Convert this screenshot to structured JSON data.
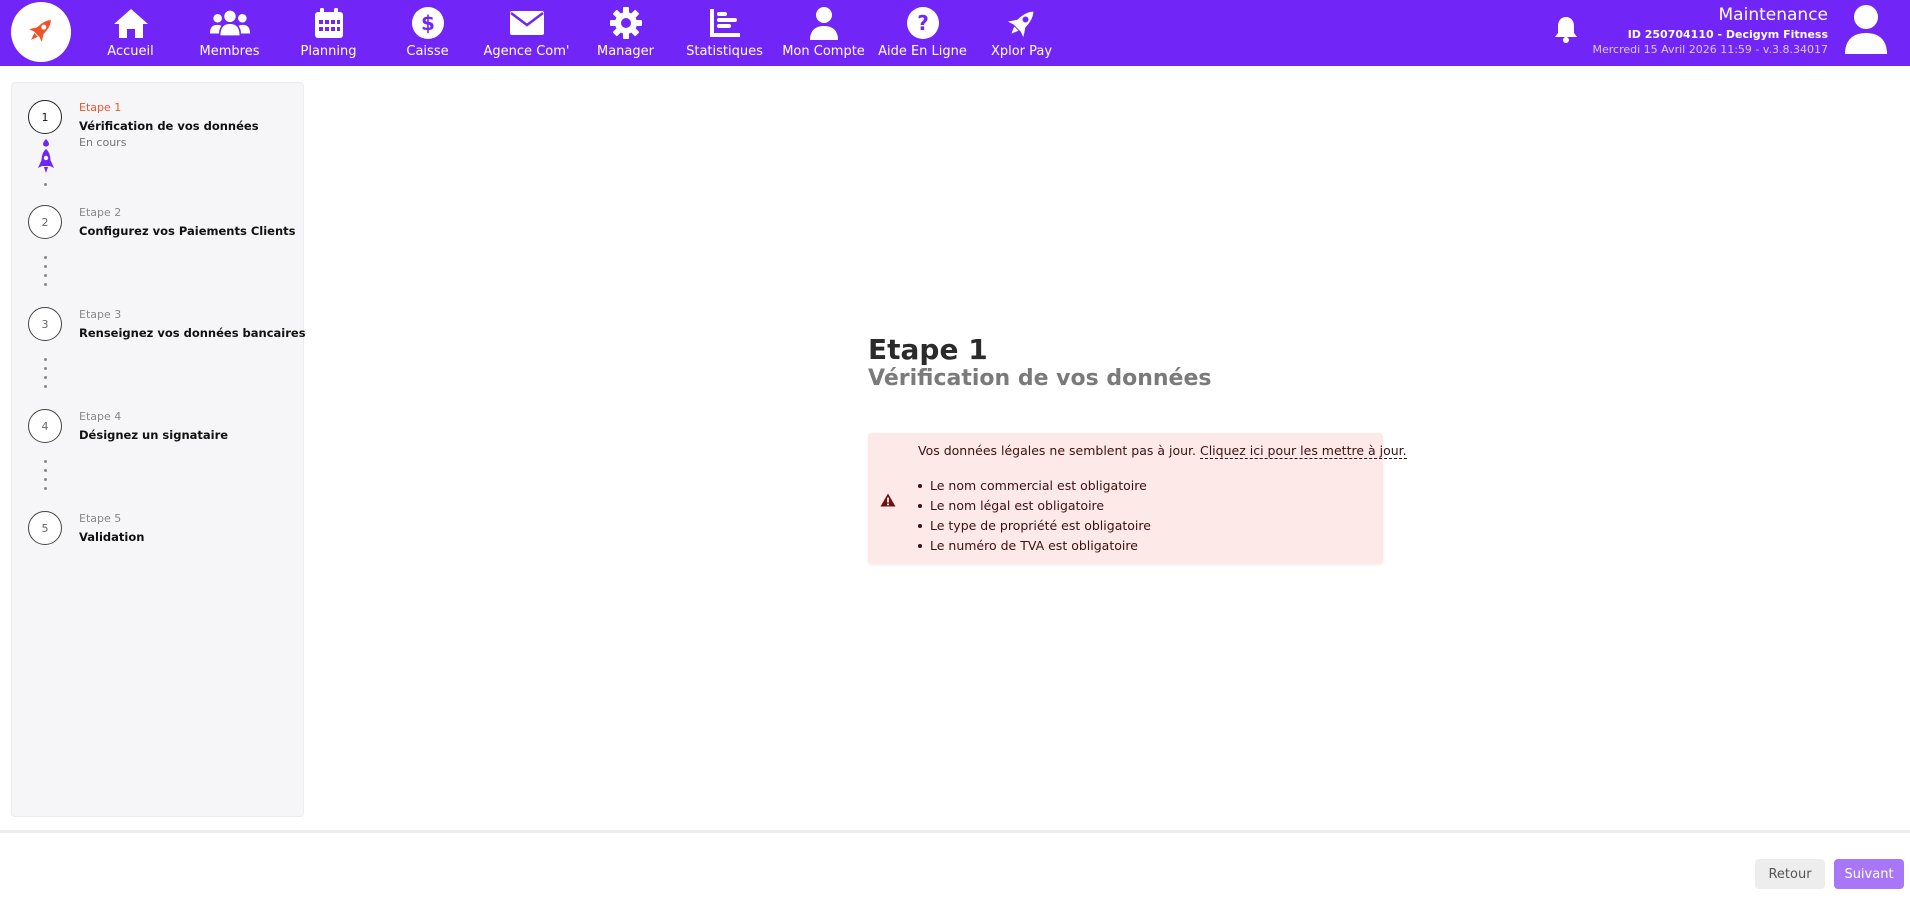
{
  "header": {
    "brand_color": "#7126f7",
    "nav": [
      {
        "label": "Accueil",
        "icon": "home-icon"
      },
      {
        "label": "Membres",
        "icon": "users-icon"
      },
      {
        "label": "Planning",
        "icon": "calendar-icon"
      },
      {
        "label": "Caisse",
        "icon": "dollar-icon"
      },
      {
        "label": "Agence Com'",
        "icon": "envelope-icon"
      },
      {
        "label": "Manager",
        "icon": "gear-icon"
      },
      {
        "label": "Statistiques",
        "icon": "chart-icon"
      },
      {
        "label": "Mon Compte",
        "icon": "user-icon"
      },
      {
        "label": "Aide En Ligne",
        "icon": "question-icon"
      },
      {
        "label": "Xplor Pay",
        "icon": "rocket-icon"
      }
    ],
    "user": {
      "name": "Maintenance",
      "id_line": "ID 250704110 - Decigym Fitness",
      "date_line": "Mercredi 15 Avril 2026 11:59 - v.3.8.34017"
    }
  },
  "steps": [
    {
      "number": "1",
      "label": "Etape 1",
      "title": "Vérification de vos données",
      "status": "En cours"
    },
    {
      "number": "2",
      "label": "Etape 2",
      "title": "Configurez vos Paiements Clients"
    },
    {
      "number": "3",
      "label": "Etape 3",
      "title": "Renseignez vos données bancaires"
    },
    {
      "number": "4",
      "label": "Etape 4",
      "title": "Désignez un signataire"
    },
    {
      "number": "5",
      "label": "Etape 5",
      "title": "Validation"
    }
  ],
  "main": {
    "title": "Etape 1",
    "subtitle": "Vérification de vos données",
    "alert": {
      "message": "Vos données légales ne semblent pas à jour.",
      "link": "Cliquez ici pour les mettre à jour.",
      "items": [
        "Le nom commercial est obligatoire",
        "Le nom légal est obligatoire",
        "Le type de propriété est obligatoire",
        "Le numéro de TVA est obligatoire"
      ]
    }
  },
  "footer": {
    "back_label": "Retour",
    "next_label": "Suivant"
  }
}
